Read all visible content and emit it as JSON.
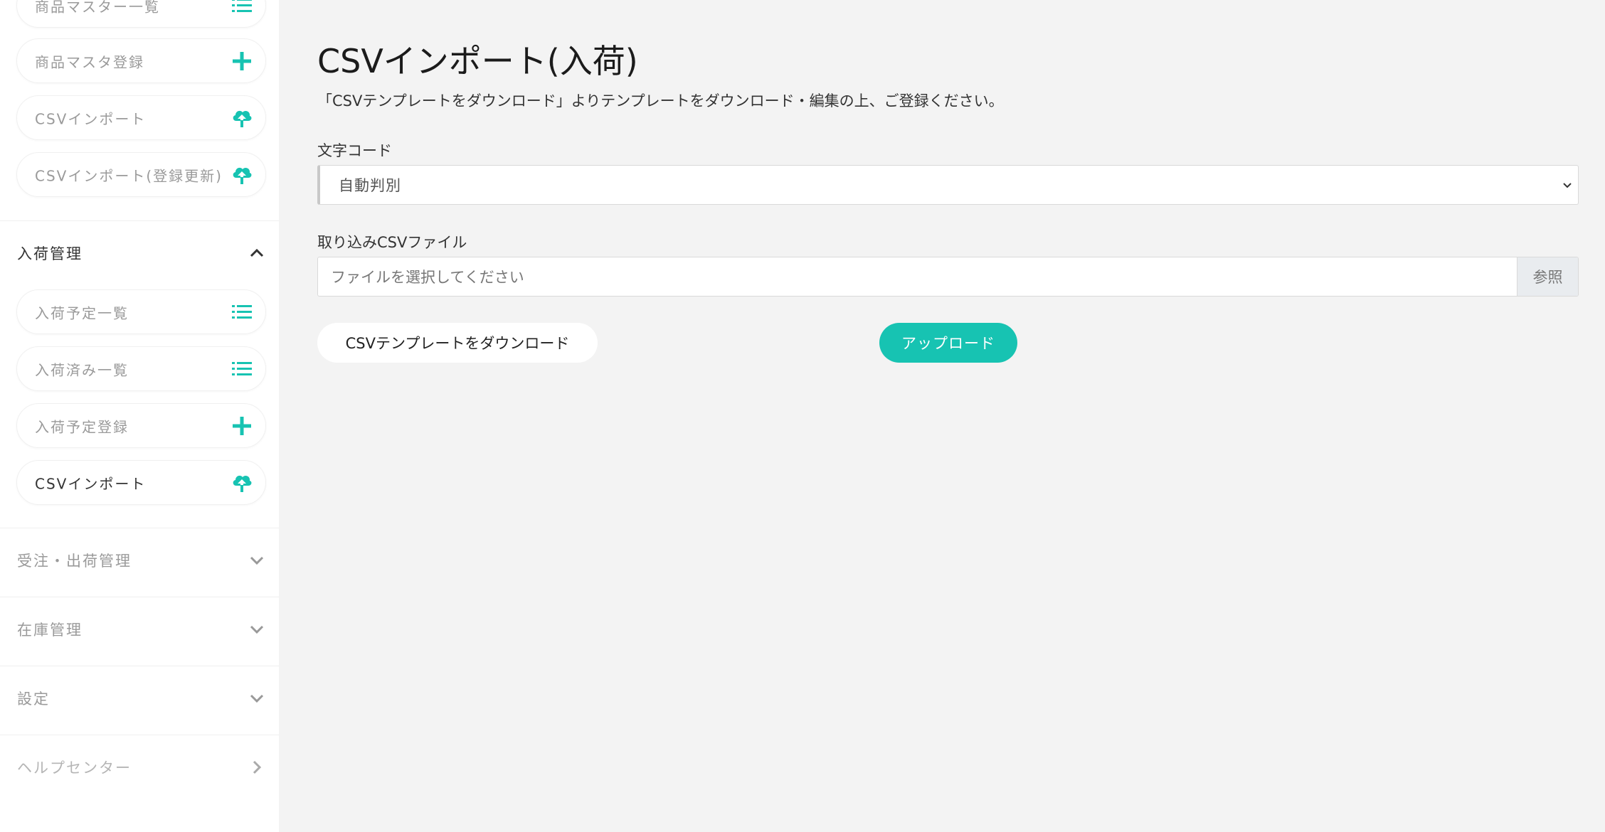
{
  "colors": {
    "accent": "#17c3b2",
    "background": "#f3f3f3",
    "sidebar": "#ffffff"
  },
  "sidebar": {
    "product_items": [
      {
        "label": "商品マスター一覧",
        "icon": "list-icon"
      },
      {
        "label": "商品マスタ登録",
        "icon": "plus-icon"
      },
      {
        "label": "CSVインポート",
        "icon": "cloud-upload-icon"
      },
      {
        "label": "CSVインポート(登録更新)",
        "icon": "cloud-upload-icon"
      }
    ],
    "arrival_section": {
      "label": "入荷管理",
      "items": [
        {
          "label": "入荷予定一覧",
          "icon": "list-icon"
        },
        {
          "label": "入荷済み一覧",
          "icon": "list-icon"
        },
        {
          "label": "入荷予定登録",
          "icon": "plus-icon"
        },
        {
          "label": "CSVインポート",
          "icon": "cloud-upload-icon",
          "active": true
        }
      ]
    },
    "sections": [
      {
        "label": "受注・出荷管理",
        "icon": "chevron-down-icon"
      },
      {
        "label": "在庫管理",
        "icon": "chevron-down-icon"
      },
      {
        "label": "設定",
        "icon": "chevron-down-icon"
      },
      {
        "label": "ヘルプセンター",
        "icon": "chevron-right-icon"
      }
    ]
  },
  "main": {
    "title": "CSVインポート(入荷)",
    "description": "「CSVテンプレートをダウンロード」よりテンプレートをダウンロード・編集の上、ご登録ください。",
    "encoding": {
      "label": "文字コード",
      "value": "自動判別"
    },
    "file": {
      "label": "取り込みCSVファイル",
      "placeholder": "ファイルを選択してください",
      "browse": "参照"
    },
    "buttons": {
      "template": "CSVテンプレートをダウンロード",
      "upload": "アップロード"
    }
  }
}
